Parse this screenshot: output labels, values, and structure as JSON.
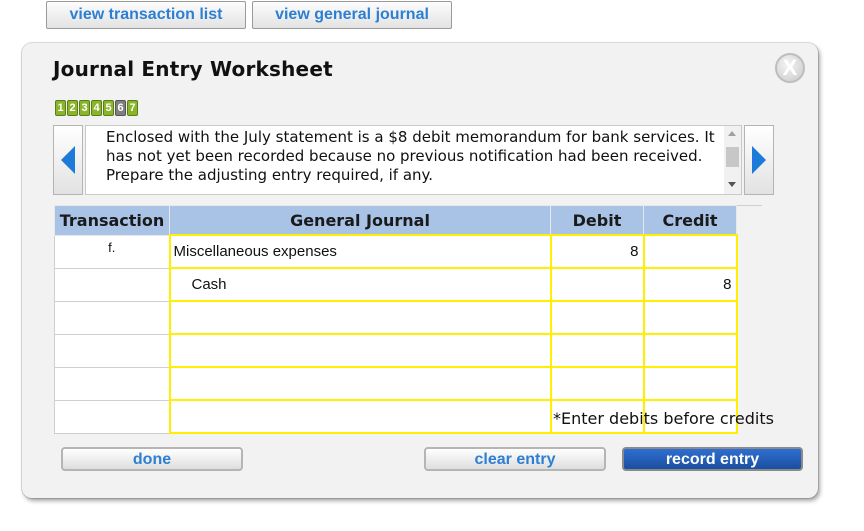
{
  "top_nav": {
    "transaction_list": "view transaction list",
    "general_journal": "view general journal"
  },
  "worksheet": {
    "title": "Journal Entry Worksheet",
    "close_label": "X",
    "steps": [
      "1",
      "2",
      "3",
      "4",
      "5",
      "6",
      "7"
    ],
    "current_step": "6",
    "description": "Enclosed with the July statement is a $8 debit memorandum for bank services. It has not yet been recorded because no previous notification had been received. Prepare the adjusting entry required, if any."
  },
  "journal_table": {
    "headers": {
      "transaction": "Transaction",
      "general_journal": "General Journal",
      "debit": "Debit",
      "credit": "Credit"
    },
    "rows": [
      {
        "transaction": "f.",
        "account": "Miscellaneous expenses",
        "debit": "8",
        "credit": ""
      },
      {
        "transaction": "",
        "account": "Cash",
        "debit": "",
        "credit": "8"
      },
      {
        "transaction": "",
        "account": "",
        "debit": "",
        "credit": ""
      },
      {
        "transaction": "",
        "account": "",
        "debit": "",
        "credit": ""
      },
      {
        "transaction": "",
        "account": "",
        "debit": "",
        "credit": ""
      },
      {
        "transaction": "",
        "account": "",
        "debit": "",
        "credit": ""
      }
    ],
    "hint": "*Enter debits before credits"
  },
  "buttons": {
    "done": "done",
    "clear_entry": "clear entry",
    "record_entry": "record entry"
  },
  "colors": {
    "header_fill": "#a9c3e6",
    "step_green": "#8ab42a",
    "step_current": "#7f7f7f",
    "input_border": "#ffef00",
    "primary_button": "#1f5bb5",
    "link_blue": "#2d7fd3"
  }
}
